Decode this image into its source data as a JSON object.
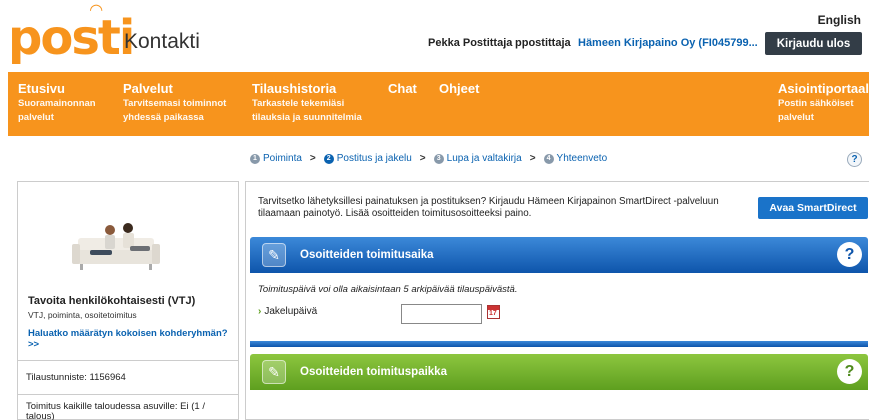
{
  "header": {
    "logo_text": "posti",
    "app_name": "Kontakti",
    "language_link": "English",
    "user_name": "Pekka Postittaja",
    "user_login": "ppostittaja",
    "organization": "Hämeen Kirjapaino Oy (FI045799...",
    "logout_label": "Kirjaudu ulos"
  },
  "nav": {
    "items": [
      {
        "title": "Etusivu",
        "sub1": "Suoramainonnan",
        "sub2": "palvelut"
      },
      {
        "title": "Palvelut",
        "sub1": "Tarvitsemasi toiminnot",
        "sub2": "yhdessä paikassa"
      },
      {
        "title": "Tilaushistoria",
        "sub1": "Tarkastele tekemiäsi",
        "sub2": "tilauksia ja suunnitelmia"
      },
      {
        "title": "Chat",
        "sub1": "",
        "sub2": ""
      },
      {
        "title": "Ohjeet",
        "sub1": "",
        "sub2": ""
      },
      {
        "title": "Asiointiportaali",
        "sub1": "Postin sähköiset",
        "sub2": "palvelut"
      }
    ]
  },
  "steps": [
    {
      "num": "1",
      "label": "Poiminta"
    },
    {
      "num": "2",
      "label": "Postitus ja jakelu"
    },
    {
      "num": "3",
      "label": "Lupa ja valtakirja"
    },
    {
      "num": "4",
      "label": "Yhteenveto"
    }
  ],
  "step_separator": ">",
  "help_symbol": "?",
  "left_panel": {
    "promo_title": "Tavoita henkilökohtaisesti (VTJ)",
    "promo_sub": "VTJ, poiminta, osoitetoimitus",
    "promo_link": "Haluatko määrätyn kokoisen kohderyhmän? >>",
    "order_id": "Tilaustunniste: 1156964",
    "delivery_info": "Toimitus kaikille taloudessa asuville: Ei (1 / talous)"
  },
  "right_panel": {
    "info_text": "Tarvitsetko lähetyksillesi painatuksen ja postituksen? Kirjaudu Hämeen Kirjapainon SmartDirect -palveluun tilaamaan painotyö. Lisää osoitteiden toimitusosoitteeksi paino.",
    "smartdirect_label": "Avaa SmartDirect",
    "section1_title": "Osoitteiden toimitusaika",
    "note": "Toimituspäivä voi olla aikaisintaan 5 arkipäivää tilauspäivästä.",
    "field_label": "Jakelupäivä",
    "date_value": "",
    "calendar_day": "17",
    "section2_title": "Osoitteiden toimituspaikka"
  },
  "colors": {
    "brand_orange": "#f7941d",
    "link_blue": "#0a62b0",
    "section_blue": "#0e55ab",
    "section_green": "#5e9f1f",
    "button_dark": "#333d47"
  }
}
